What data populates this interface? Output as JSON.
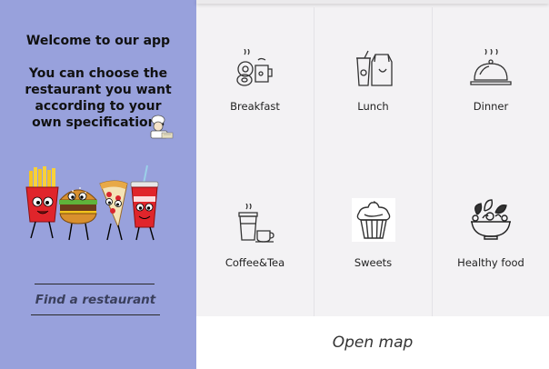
{
  "sidebar": {
    "welcome_title": "Welcome to our app",
    "welcome_text": "You can choose the restaurant you want according to your own specifications",
    "find_button": "Find a restaurant"
  },
  "categories": [
    {
      "label": "Breakfast",
      "icon": "breakfast-icon"
    },
    {
      "label": "Lunch",
      "icon": "lunch-icon"
    },
    {
      "label": "Dinner",
      "icon": "dinner-cloche-icon"
    },
    {
      "label": "Coffee&Tea",
      "icon": "coffee-tea-icon"
    },
    {
      "label": "Sweets",
      "icon": "cupcake-icon"
    },
    {
      "label": "Healthy food",
      "icon": "salad-bowl-icon"
    }
  ],
  "open_map": "Open map",
  "colors": {
    "sidebar_bg": "#98a1dc",
    "main_bg": "#f3f2f4"
  }
}
